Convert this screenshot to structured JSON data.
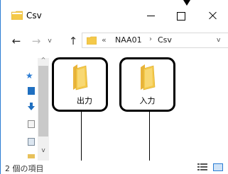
{
  "window": {
    "title": "Csv",
    "controls": {
      "minimize": "minimize",
      "maximize": "maximize",
      "close": "close"
    }
  },
  "navigation": {
    "back_icon": "←",
    "forward_icon": "→",
    "recent_icon": "v",
    "up_icon": "↑"
  },
  "address": {
    "overflow": "«",
    "breadcrumbs": [
      "NAA01",
      "Csv"
    ],
    "separator": "›",
    "dropdown_icon": "v"
  },
  "navpane": {
    "icons": [
      "pin-icon",
      "desktop-icon",
      "downloads-icon",
      "documents-icon",
      "pictures-icon",
      "folder-icon"
    ],
    "pin": "★",
    "scroll_up": "^",
    "scroll_down": "v"
  },
  "items": [
    {
      "label": "出力"
    },
    {
      "label": "入力"
    }
  ],
  "status": {
    "count_text": "2 個の項目"
  },
  "colors": {
    "folder": "#f4c94a",
    "accent": "#2b7cd3"
  }
}
